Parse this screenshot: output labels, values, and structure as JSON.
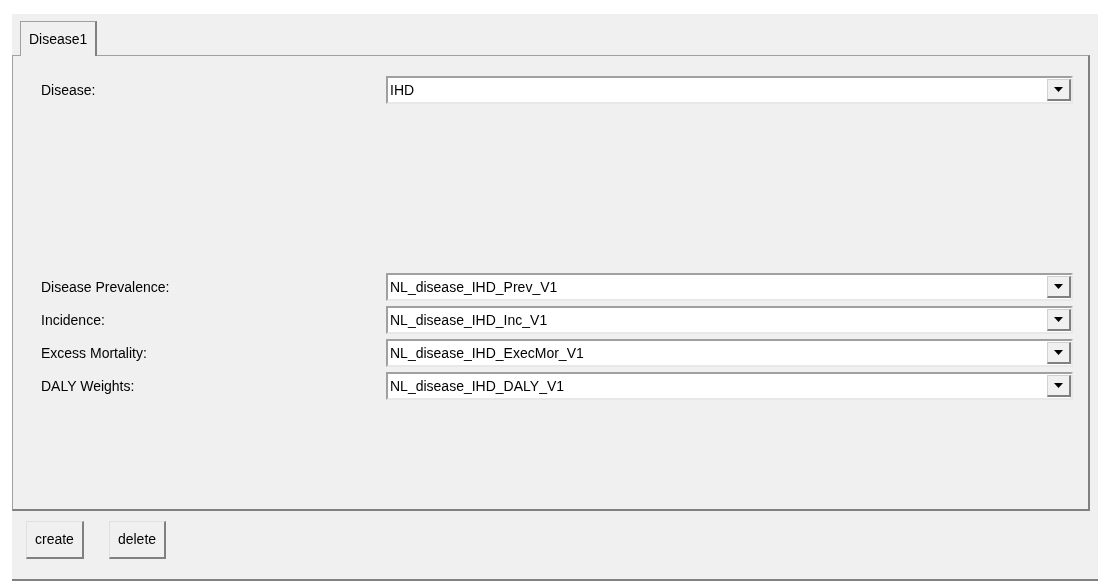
{
  "tabs": [
    {
      "label": "Disease1",
      "selected": true
    }
  ],
  "rows": [
    {
      "label": "Disease:",
      "value": "IHD"
    },
    {
      "label": "Disease Prevalence:",
      "value": "NL_disease_IHD_Prev_V1"
    },
    {
      "label": "Incidence:",
      "value": "NL_disease_IHD_Inc_V1"
    },
    {
      "label": "Excess Mortality:",
      "value": "NL_disease_IHD_ExecMor_V1"
    },
    {
      "label": "DALY Weights:",
      "value": "NL_disease_IHD_DALY_V1"
    }
  ],
  "buttons": [
    "create",
    "delete"
  ]
}
